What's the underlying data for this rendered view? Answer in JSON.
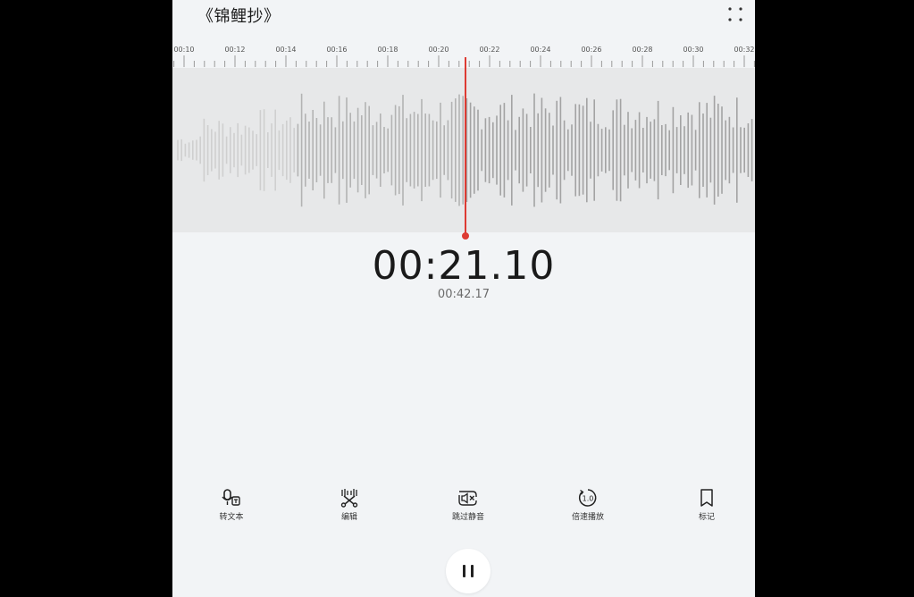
{
  "header": {
    "title": "《锦鲤抄》",
    "more_icon": "more-grid-icon"
  },
  "ruler": {
    "labels": [
      "00:10",
      "00:12",
      "00:14",
      "00:16",
      "00:18",
      "00:20",
      "00:22",
      "00:24",
      "00:26",
      "00:28",
      "00:30",
      "00:32"
    ]
  },
  "player": {
    "current_time": "00:21.10",
    "total_time": "00:42.17",
    "progress": 0.5004
  },
  "toolbar": {
    "items": [
      {
        "label": "转文本",
        "icon": "speech-to-text-icon"
      },
      {
        "label": "编辑",
        "icon": "scissors-edit-icon"
      },
      {
        "label": "跳过静音",
        "icon": "skip-silence-icon"
      },
      {
        "label": "倍速播放",
        "icon": "playback-speed-icon"
      },
      {
        "label": "标记",
        "icon": "bookmark-icon"
      }
    ],
    "speed_value": "1.0"
  },
  "colors": {
    "playhead": "#dd3b33",
    "background": "#f2f4f6",
    "wave_band": "#e7e8e9"
  }
}
